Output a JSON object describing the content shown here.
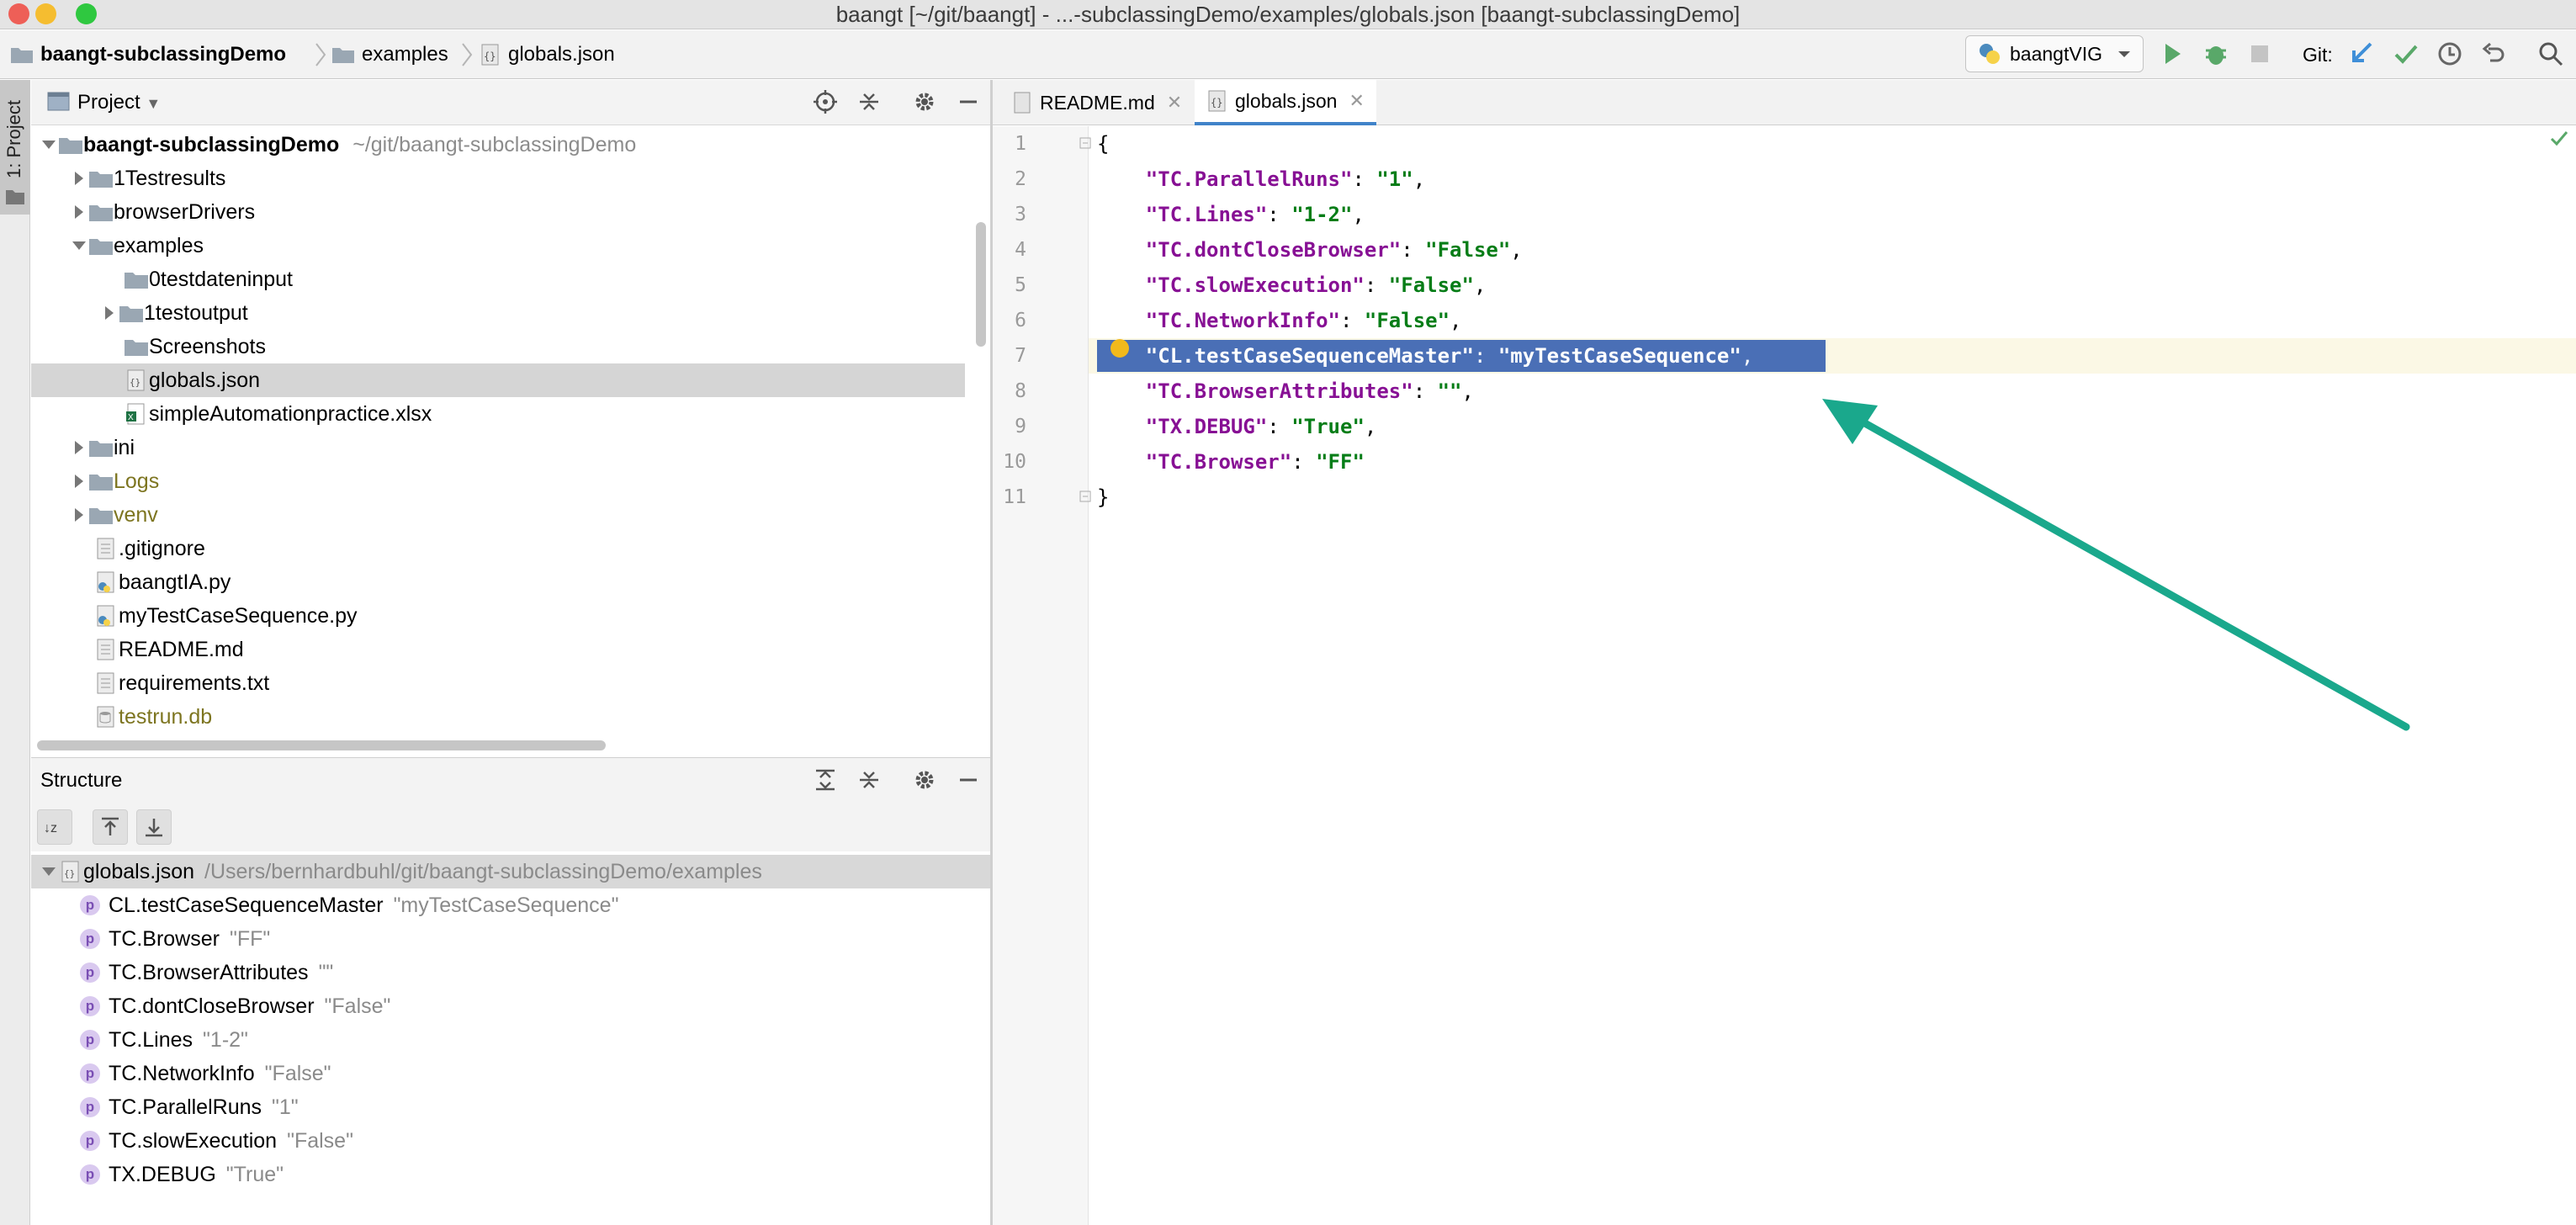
{
  "window": {
    "title": "baangt [~/git/baangt] - ...-subclassingDemo/examples/globals.json [baangt-subclassingDemo]"
  },
  "navbar": {
    "breadcrumbs": [
      "baangt-subclassingDemo",
      "examples",
      "globals.json"
    ],
    "run_config": "baangtVIG",
    "git_label": "Git:"
  },
  "sidebar_stripe": {
    "project_tab": "1: Project"
  },
  "project_panel": {
    "title": "Project",
    "tree": [
      {
        "label": "baangt-subclassingDemo",
        "path": "~/git/baangt-subclassingDemo",
        "kind": "folder",
        "expanded": true
      },
      {
        "label": "1Testresults",
        "kind": "folder",
        "expanded": false
      },
      {
        "label": "browserDrivers",
        "kind": "folder",
        "expanded": false
      },
      {
        "label": "examples",
        "kind": "folder",
        "expanded": true
      },
      {
        "label": "0testdateninput",
        "kind": "folder"
      },
      {
        "label": "1testoutput",
        "kind": "folder",
        "expanded": false
      },
      {
        "label": "Screenshots",
        "kind": "folder"
      },
      {
        "label": "globals.json",
        "kind": "json",
        "selected": true
      },
      {
        "label": "simpleAutomationpractice.xlsx",
        "kind": "xlsx"
      },
      {
        "label": "ini",
        "kind": "folder",
        "expanded": false
      },
      {
        "label": "Logs",
        "kind": "folder",
        "expanded": false
      },
      {
        "label": "venv",
        "kind": "folder",
        "expanded": false
      },
      {
        "label": ".gitignore",
        "kind": "file"
      },
      {
        "label": "baangtIA.py",
        "kind": "python"
      },
      {
        "label": "myTestCaseSequence.py",
        "kind": "python"
      },
      {
        "label": "README.md",
        "kind": "file"
      },
      {
        "label": "requirements.txt",
        "kind": "file"
      },
      {
        "label": "testrun.db",
        "kind": "db"
      }
    ]
  },
  "structure_panel": {
    "title": "Structure",
    "root": {
      "label": "globals.json",
      "path": "/Users/bernhardbuhl/git/baangt-subclassingDemo/examples"
    },
    "badge": "p",
    "items": [
      {
        "key": "CL.testCaseSequenceMaster",
        "value": "\"myTestCaseSequence\""
      },
      {
        "key": "TC.Browser",
        "value": "\"FF\""
      },
      {
        "key": "TC.BrowserAttributes",
        "value": "\"\""
      },
      {
        "key": "TC.dontCloseBrowser",
        "value": "\"False\""
      },
      {
        "key": "TC.Lines",
        "value": "\"1-2\""
      },
      {
        "key": "TC.NetworkInfo",
        "value": "\"False\""
      },
      {
        "key": "TC.ParallelRuns",
        "value": "\"1\""
      },
      {
        "key": "TC.slowExecution",
        "value": "\"False\""
      },
      {
        "key": "TX.DEBUG",
        "value": "\"True\""
      }
    ]
  },
  "editor": {
    "tabs": [
      {
        "label": "README.md",
        "active": false
      },
      {
        "label": "globals.json",
        "active": true
      }
    ],
    "line_numbers": [
      "1",
      "2",
      "3",
      "4",
      "5",
      "6",
      "7",
      "8",
      "9",
      "10",
      "11"
    ],
    "lines": [
      {
        "parts": [
          [
            "p",
            "{"
          ]
        ]
      },
      {
        "parts": [
          [
            "p",
            "    "
          ],
          [
            "k",
            "\"TC.ParallelRuns\""
          ],
          [
            "p",
            ": "
          ],
          [
            "s",
            "\"1\""
          ],
          [
            "p",
            ","
          ]
        ]
      },
      {
        "parts": [
          [
            "p",
            "    "
          ],
          [
            "k",
            "\"TC.Lines\""
          ],
          [
            "p",
            ": "
          ],
          [
            "s",
            "\"1-2\""
          ],
          [
            "p",
            ","
          ]
        ]
      },
      {
        "parts": [
          [
            "p",
            "    "
          ],
          [
            "k",
            "\"TC.dontCloseBrowser\""
          ],
          [
            "p",
            ": "
          ],
          [
            "s",
            "\"False\""
          ],
          [
            "p",
            ","
          ]
        ]
      },
      {
        "parts": [
          [
            "p",
            "    "
          ],
          [
            "k",
            "\"TC.slowExecution\""
          ],
          [
            "p",
            ": "
          ],
          [
            "s",
            "\"False\""
          ],
          [
            "p",
            ","
          ]
        ]
      },
      {
        "parts": [
          [
            "p",
            "    "
          ],
          [
            "k",
            "\"TC.NetworkInfo\""
          ],
          [
            "p",
            ": "
          ],
          [
            "s",
            "\"False\""
          ],
          [
            "p",
            ","
          ]
        ]
      },
      {
        "parts": [
          [
            "p",
            "    "
          ],
          [
            "k",
            "\"CL.testCaseSequenceMaster\""
          ],
          [
            "p",
            ": "
          ],
          [
            "s",
            "\"myTestCaseSequence\""
          ],
          [
            "p",
            ","
          ]
        ],
        "selected": true
      },
      {
        "parts": [
          [
            "p",
            "    "
          ],
          [
            "k",
            "\"TC.BrowserAttributes\""
          ],
          [
            "p",
            ": "
          ],
          [
            "s",
            "\"\""
          ],
          [
            "p",
            ","
          ]
        ]
      },
      {
        "parts": [
          [
            "p",
            "    "
          ],
          [
            "k",
            "\"TX.DEBUG\""
          ],
          [
            "p",
            ": "
          ],
          [
            "s",
            "\"True\""
          ],
          [
            "p",
            ","
          ]
        ]
      },
      {
        "parts": [
          [
            "p",
            "    "
          ],
          [
            "k",
            "\"TC.Browser\""
          ],
          [
            "p",
            ": "
          ],
          [
            "s",
            "\"FF\""
          ]
        ]
      },
      {
        "parts": [
          [
            "p",
            "}"
          ]
        ]
      }
    ]
  },
  "colors": {
    "selection": "#4a6fb6",
    "annotation_arrow": "#1aa88c",
    "json_key": "#871094",
    "json_string": "#067d17"
  }
}
